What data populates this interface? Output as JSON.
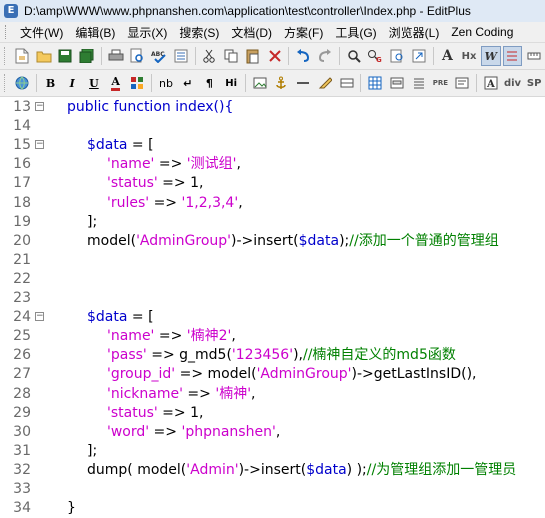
{
  "window": {
    "title": "D:\\amp\\WWW\\www.phpnanshen.com\\application\\test\\controller\\Index.php - EditPlus"
  },
  "menu": [
    "文件(W)",
    "编辑(B)",
    "显示(X)",
    "搜索(S)",
    "文档(D)",
    "方案(F)",
    "工具(G)",
    "浏览器(L)",
    "Zen Coding"
  ],
  "toolbar1": [
    "new-file-icon",
    "open-folder-icon",
    "save-icon",
    "save-all-icon",
    "print-icon",
    "print-preview-icon",
    "spell-check-icon",
    "hex-view-icon",
    "cut-icon",
    "copy-icon",
    "paste-icon",
    "delete-icon",
    "undo-icon",
    "redo-icon",
    "find-icon",
    "replace-icon",
    "find-in-files-icon",
    "goto-icon",
    "font-size-icon",
    "word-wrap-icon",
    "line-number-icon",
    "ruler-icon"
  ],
  "toolbar1_labels": {
    "font": "A",
    "hex": "Hx",
    "wrap": "W"
  },
  "toolbar2_labels": {
    "bold": "B",
    "italic": "I",
    "underline": "U",
    "fontcolor": "A",
    "nbsp": "nb",
    "br": "↵",
    "para": "¶",
    "hi": "Hi",
    "pre": "PRE",
    "div": "div",
    "sp": "SP"
  },
  "editor": {
    "lines": [
      {
        "n": "13",
        "fold": true,
        "indent": 0,
        "tokens": [
          [
            "k",
            "public function index(){"
          ]
        ]
      },
      {
        "n": "14",
        "fold": false,
        "indent": 0,
        "tokens": []
      },
      {
        "n": "15",
        "fold": true,
        "indent": 1,
        "tokens": [
          [
            "v",
            "$data"
          ],
          [
            "n",
            " = ["
          ]
        ]
      },
      {
        "n": "16",
        "fold": false,
        "indent": 2,
        "tokens": [
          [
            "s",
            "'name'"
          ],
          [
            "n",
            " => "
          ],
          [
            "s",
            "'测试组'"
          ],
          [
            "n",
            ","
          ]
        ]
      },
      {
        "n": "17",
        "fold": false,
        "indent": 2,
        "tokens": [
          [
            "s",
            "'status'"
          ],
          [
            "n",
            " => 1,"
          ]
        ]
      },
      {
        "n": "18",
        "fold": false,
        "indent": 2,
        "tokens": [
          [
            "s",
            "'rules'"
          ],
          [
            "n",
            " => "
          ],
          [
            "s",
            "'1,2,3,4'"
          ],
          [
            "n",
            ","
          ]
        ]
      },
      {
        "n": "19",
        "fold": false,
        "indent": 1,
        "tokens": [
          [
            "n",
            "];"
          ]
        ]
      },
      {
        "n": "20",
        "fold": false,
        "indent": 1,
        "tokens": [
          [
            "n",
            "model("
          ],
          [
            "s",
            "'AdminGroup'"
          ],
          [
            "n",
            ")->insert("
          ],
          [
            "v",
            "$data"
          ],
          [
            "n",
            ");"
          ],
          [
            "c",
            "//添加一个普通的管理组"
          ]
        ]
      },
      {
        "n": "21",
        "fold": false,
        "indent": 0,
        "tokens": []
      },
      {
        "n": "22",
        "fold": false,
        "indent": 0,
        "tokens": []
      },
      {
        "n": "23",
        "fold": false,
        "indent": 0,
        "tokens": []
      },
      {
        "n": "24",
        "fold": true,
        "indent": 1,
        "tokens": [
          [
            "v",
            "$data"
          ],
          [
            "n",
            " = ["
          ]
        ]
      },
      {
        "n": "25",
        "fold": false,
        "indent": 2,
        "tokens": [
          [
            "s",
            "'name'"
          ],
          [
            "n",
            " => "
          ],
          [
            "s",
            "'楠神2'"
          ],
          [
            "n",
            ","
          ]
        ]
      },
      {
        "n": "26",
        "fold": false,
        "indent": 2,
        "tokens": [
          [
            "s",
            "'pass'"
          ],
          [
            "n",
            " => g_md5("
          ],
          [
            "s",
            "'123456'"
          ],
          [
            "n",
            "),"
          ],
          [
            "c",
            "//楠神自定义的md5函数"
          ]
        ]
      },
      {
        "n": "27",
        "fold": false,
        "indent": 2,
        "tokens": [
          [
            "s",
            "'group_id'"
          ],
          [
            "n",
            " => model("
          ],
          [
            "s",
            "'AdminGroup'"
          ],
          [
            "n",
            ")->getLastInsID(),"
          ]
        ]
      },
      {
        "n": "28",
        "fold": false,
        "indent": 2,
        "tokens": [
          [
            "s",
            "'nickname'"
          ],
          [
            "n",
            " => "
          ],
          [
            "s",
            "'楠神'"
          ],
          [
            "n",
            ","
          ]
        ]
      },
      {
        "n": "29",
        "fold": false,
        "indent": 2,
        "tokens": [
          [
            "s",
            "'status'"
          ],
          [
            "n",
            " => 1,"
          ]
        ]
      },
      {
        "n": "30",
        "fold": false,
        "indent": 2,
        "tokens": [
          [
            "s",
            "'word'"
          ],
          [
            "n",
            " => "
          ],
          [
            "s",
            "'phpnanshen'"
          ],
          [
            "n",
            ","
          ]
        ]
      },
      {
        "n": "31",
        "fold": false,
        "indent": 1,
        "tokens": [
          [
            "n",
            "];"
          ]
        ]
      },
      {
        "n": "32",
        "fold": false,
        "indent": 1,
        "tokens": [
          [
            "n",
            "dump( model("
          ],
          [
            "s",
            "'Admin'"
          ],
          [
            "n",
            ")->insert("
          ],
          [
            "v",
            "$data"
          ],
          [
            "n",
            ") );"
          ],
          [
            "c",
            "//为管理组添加一管理员"
          ]
        ]
      },
      {
        "n": "33",
        "fold": false,
        "indent": 0,
        "tokens": []
      },
      {
        "n": "34",
        "fold": false,
        "indent": 0,
        "tokens": [
          [
            "n",
            "}"
          ]
        ]
      }
    ]
  }
}
